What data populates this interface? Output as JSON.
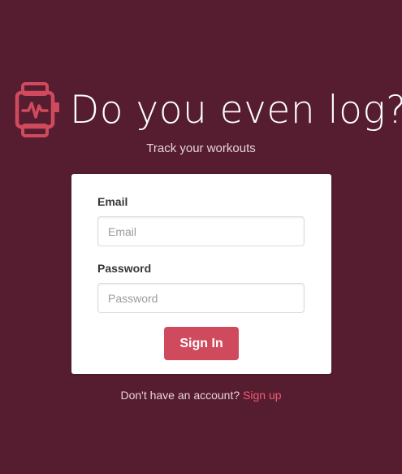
{
  "brand": {
    "title": "Do you even log?",
    "icon": "smartwatch-heartbeat-icon",
    "accent_color": "#d04a5e"
  },
  "tagline": "Track your workouts",
  "form": {
    "email_label": "Email",
    "email_placeholder": "Email",
    "email_value": "",
    "password_label": "Password",
    "password_placeholder": "Password",
    "password_value": "",
    "submit_label": "Sign In"
  },
  "footer": {
    "prompt": "Don't have an account?",
    "link_label": "Sign up"
  },
  "colors": {
    "background": "#561d30",
    "card": "#ffffff",
    "button": "#d04a5e",
    "link": "#ef5b72"
  }
}
